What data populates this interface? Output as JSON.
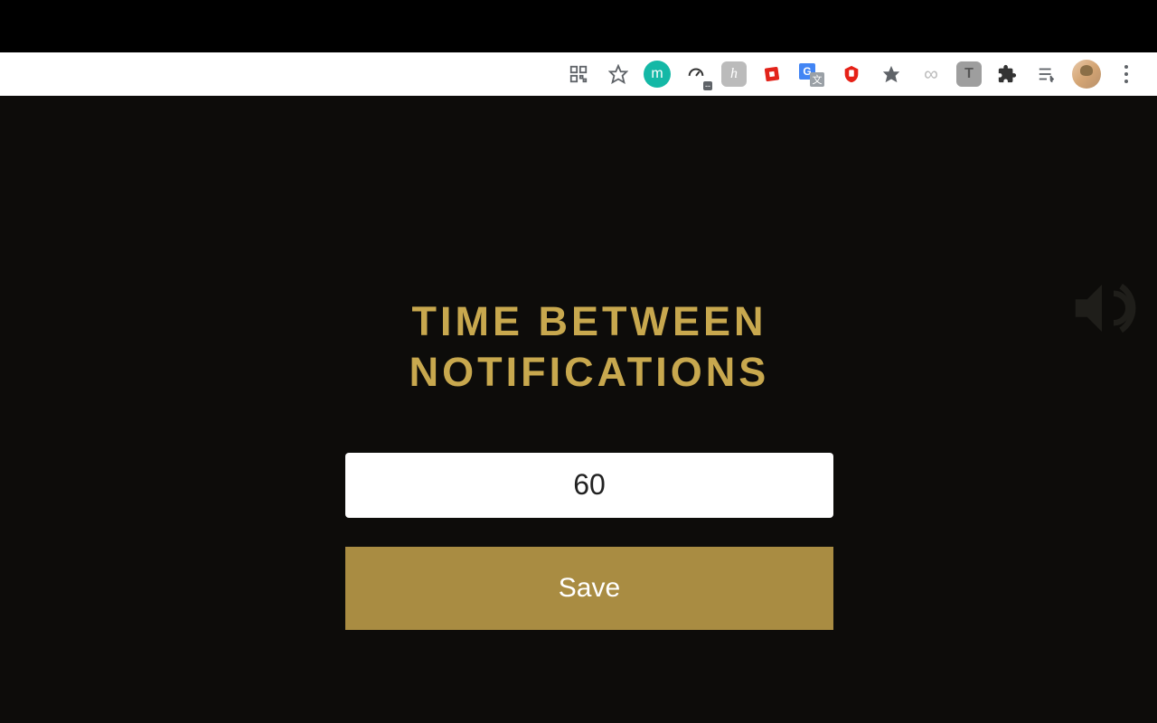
{
  "toolbar": {
    "m_badge": "m",
    "speed_mini": "--",
    "h_badge": "h",
    "translate_g": "G",
    "translate_x": "文",
    "t_badge": "T",
    "infinity": "∞"
  },
  "popup": {
    "heading_line1": "TIME BETWEEN",
    "heading_line2": "NOTIFICATIONS",
    "input_value": "60",
    "save_label": "Save"
  }
}
